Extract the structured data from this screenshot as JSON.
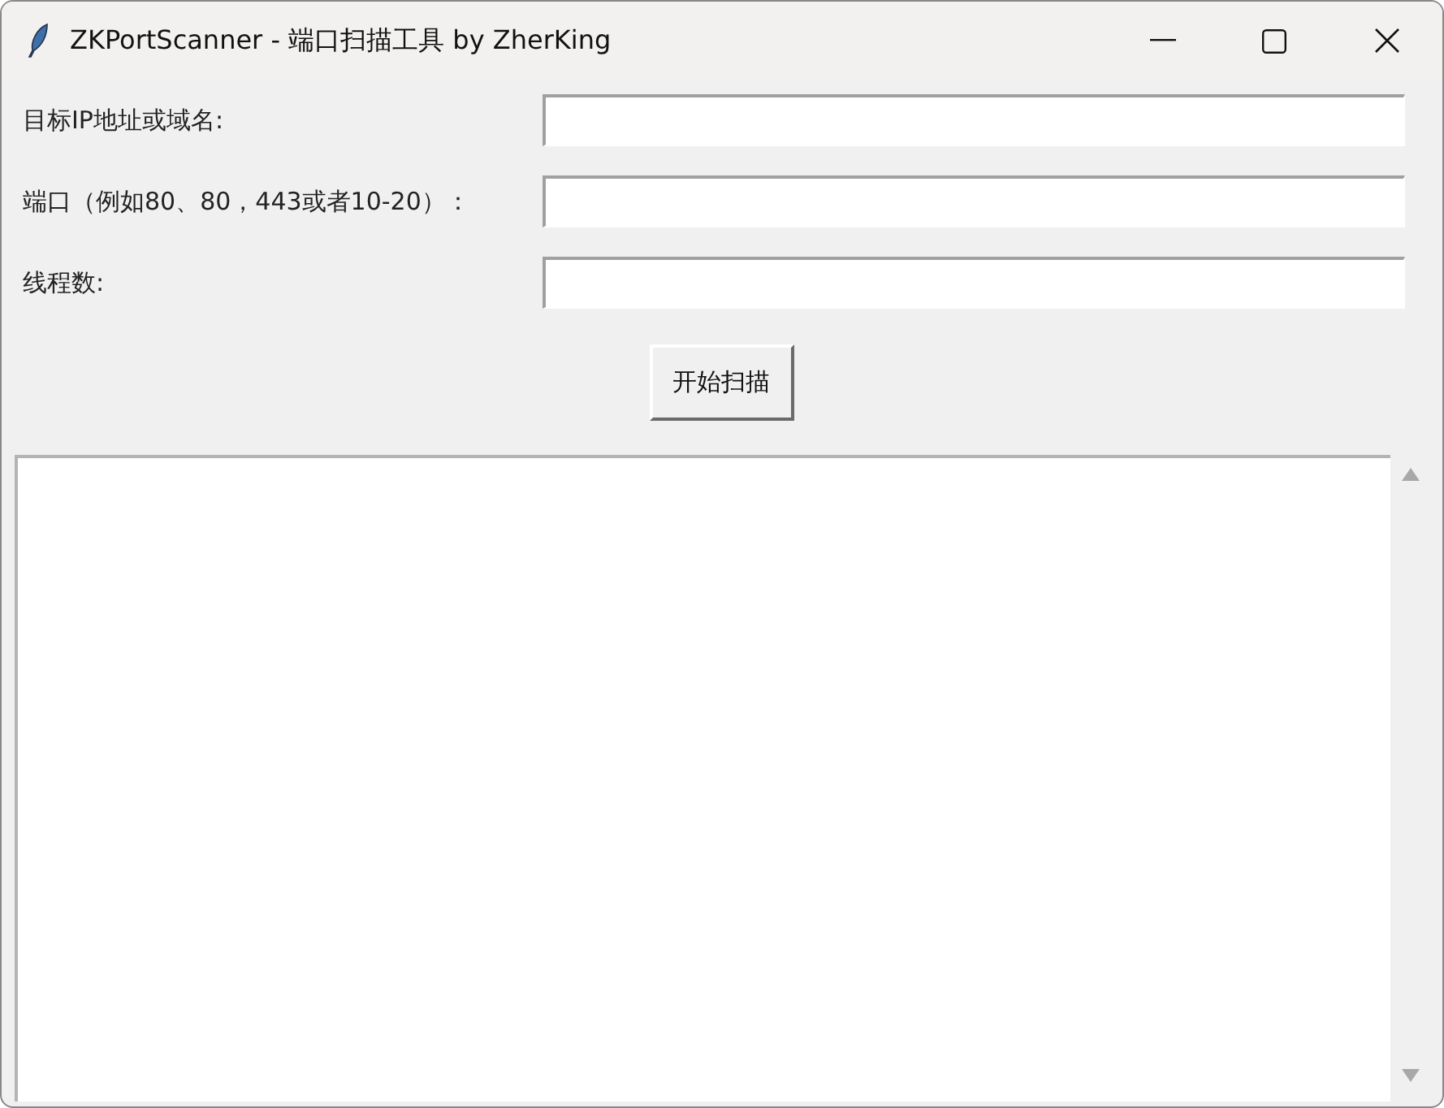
{
  "window": {
    "title": "ZKPortScanner - 端口扫描工具 by ZherKing"
  },
  "fields": [
    {
      "label": "目标IP地址或域名:"
    },
    {
      "label": "端口（例如80、80，443或者10-20）："
    },
    {
      "label": "线程数:"
    }
  ],
  "buttons": [
    "开始扫描"
  ]
}
